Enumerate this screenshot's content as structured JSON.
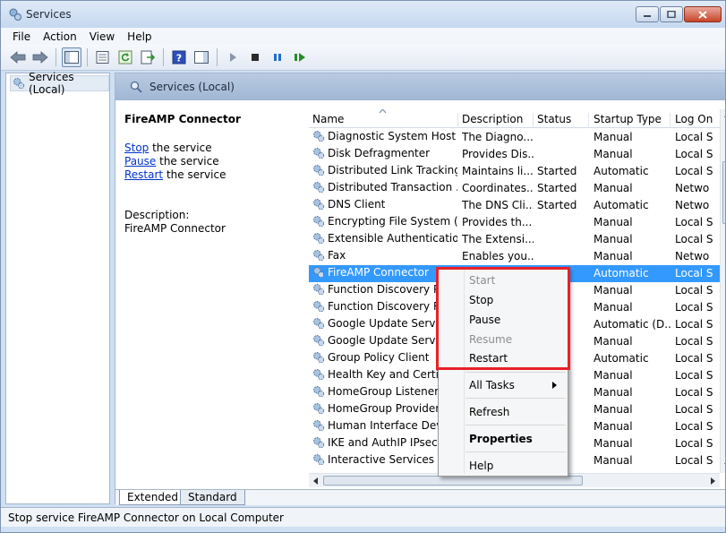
{
  "window": {
    "title": "Services"
  },
  "menu": [
    "File",
    "Action",
    "View",
    "Help"
  ],
  "tree": {
    "root": "Services (Local)"
  },
  "panel": {
    "header": "Services (Local)"
  },
  "details": {
    "service_name": "FireAMP Connector",
    "stop_link": "Stop",
    "stop_rest": " the service",
    "pause_link": "Pause",
    "pause_rest": " the service",
    "restart_link": "Restart",
    "restart_rest": " the service",
    "description_label": "Description:",
    "description_text": "FireAMP Connector"
  },
  "columns": {
    "name": "Name",
    "description": "Description",
    "status": "Status",
    "startup": "Startup Type",
    "logon": "Log On"
  },
  "services": [
    {
      "name": "Diagnostic System Host",
      "description": "The Diagno...",
      "status": "",
      "startup": "Manual",
      "logon": "Local S"
    },
    {
      "name": "Disk Defragmenter",
      "description": "Provides Dis...",
      "status": "",
      "startup": "Manual",
      "logon": "Local S"
    },
    {
      "name": "Distributed Link Tracking...",
      "description": "Maintains li...",
      "status": "Started",
      "startup": "Automatic",
      "logon": "Local S"
    },
    {
      "name": "Distributed Transaction ...",
      "description": "Coordinates...",
      "status": "Started",
      "startup": "Manual",
      "logon": "Netwo"
    },
    {
      "name": "DNS Client",
      "description": "The DNS Cli...",
      "status": "Started",
      "startup": "Automatic",
      "logon": "Netwo"
    },
    {
      "name": "Encrypting File System (E...",
      "description": "Provides th...",
      "status": "",
      "startup": "Manual",
      "logon": "Local S"
    },
    {
      "name": "Extensible Authenticatio...",
      "description": "The Extensi...",
      "status": "",
      "startup": "Manual",
      "logon": "Local S"
    },
    {
      "name": "Fax",
      "description": "Enables you...",
      "status": "",
      "startup": "Manual",
      "logon": "Netwo"
    },
    {
      "name": "FireAMP Connector",
      "description": "",
      "status": "",
      "startup": "Automatic",
      "logon": "Local S"
    },
    {
      "name": "Function Discovery Pro",
      "description": "",
      "status": "",
      "startup": "Manual",
      "logon": "Local S"
    },
    {
      "name": "Function Discovery Res",
      "description": "",
      "status": "",
      "startup": "Manual",
      "logon": "Local S"
    },
    {
      "name": "Google Update Service",
      "description": "",
      "status": "",
      "startup": "Automatic (D...",
      "logon": "Local S"
    },
    {
      "name": "Google Update Service",
      "description": "",
      "status": "",
      "startup": "Manual",
      "logon": "Local S"
    },
    {
      "name": "Group Policy Client",
      "description": "",
      "status": "",
      "startup": "Automatic",
      "logon": "Local S"
    },
    {
      "name": "Health Key and Certifica",
      "description": "",
      "status": "",
      "startup": "Manual",
      "logon": "Local S"
    },
    {
      "name": "HomeGroup Listener",
      "description": "",
      "status": "",
      "startup": "Manual",
      "logon": "Local S"
    },
    {
      "name": "HomeGroup Provider",
      "description": "",
      "status": "",
      "startup": "Manual",
      "logon": "Local S"
    },
    {
      "name": "Human Interface Device",
      "description": "",
      "status": "",
      "startup": "Manual",
      "logon": "Local S"
    },
    {
      "name": "IKE and AuthIP IPsec Ke",
      "description": "",
      "status": "",
      "startup": "Manual",
      "logon": "Local S"
    },
    {
      "name": "Interactive Services Dete",
      "description": "",
      "status": "",
      "startup": "Manual",
      "logon": "Local S"
    }
  ],
  "selected_index": 8,
  "context_menu": {
    "start": "Start",
    "stop": "Stop",
    "pause": "Pause",
    "resume": "Resume",
    "restart": "Restart",
    "all_tasks": "All Tasks",
    "refresh": "Refresh",
    "properties": "Properties",
    "help": "Help"
  },
  "tabs": {
    "extended": "Extended",
    "standard": "Standard"
  },
  "statusbar": {
    "text": "Stop service FireAMP Connector on Local Computer"
  },
  "colors": {
    "selection": "#3399ff",
    "highlight_box": "#e8202a",
    "link": "#0033cc"
  }
}
